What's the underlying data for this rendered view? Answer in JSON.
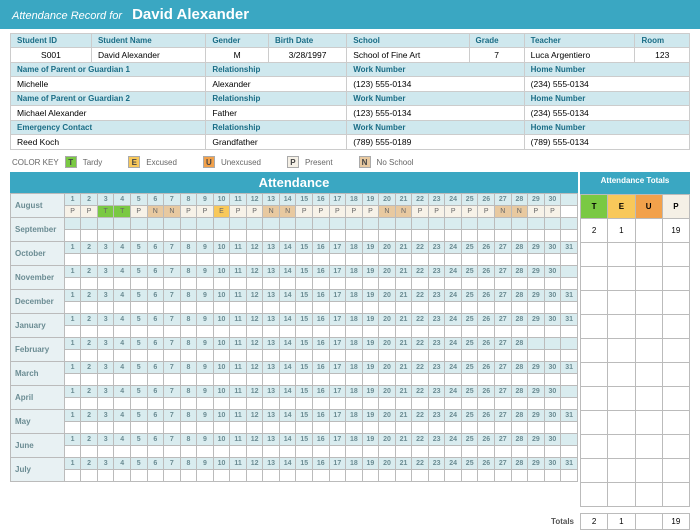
{
  "header": {
    "label": "Attendance Record for",
    "student_name": "David Alexander"
  },
  "student": {
    "id_label": "Student ID",
    "id": "S001",
    "name_label": "Student Name",
    "name": "David Alexander",
    "gender_label": "Gender",
    "gender": "M",
    "birth_label": "Birth Date",
    "birth": "3/28/1997",
    "school_label": "School",
    "school": "School of Fine Art",
    "grade_label": "Grade",
    "grade": "7",
    "teacher_label": "Teacher",
    "teacher": "Luca Argentiero",
    "room_label": "Room",
    "room": "123",
    "g1_label": "Name of Parent or Guardian 1",
    "g1_name": "Michelle",
    "g1_rel_label": "Relationship",
    "g1_rel": "Alexander",
    "g1_work_label": "Work Number",
    "g1_work": "(123) 555-0134",
    "g1_home_label": "Home Number",
    "g1_home": "(234) 555-0134",
    "g2_label": "Name of Parent or Guardian 2",
    "g2_name": "Michael Alexander",
    "g2_rel_label": "Relationship",
    "g2_rel": "Father",
    "g2_work_label": "Work Number",
    "g2_work": "(123) 555-0134",
    "g2_home_label": "Home Number",
    "g2_home": "(234) 555-0134",
    "ec_label": "Emergency Contact",
    "ec_name": "Reed Koch",
    "ec_rel_label": "Relationship",
    "ec_rel": "Grandfather",
    "ec_work_label": "Work Number",
    "ec_work": "(789) 555-0189",
    "ec_home_label": "Home Number",
    "ec_home": "(789) 555-0134"
  },
  "color_key": {
    "label": "COLOR KEY",
    "t": "Tardy",
    "e": "Excused",
    "u": "Unexcused",
    "p": "Present",
    "n": "No School"
  },
  "attendance": {
    "title": "Attendance",
    "months": [
      {
        "name": "August",
        "days": 30,
        "status": [
          "P",
          "P",
          "T",
          "T",
          "P",
          "N",
          "N",
          "P",
          "P",
          "E",
          "P",
          "P",
          "N",
          "N",
          "P",
          "P",
          "P",
          "P",
          "P",
          "N",
          "N",
          "P",
          "P",
          "P",
          "P",
          "P",
          "N",
          "N",
          "P",
          "P"
        ]
      },
      {
        "name": "September",
        "days": 0,
        "status": []
      },
      {
        "name": "October",
        "days": 31,
        "status": []
      },
      {
        "name": "November",
        "days": 30,
        "status": []
      },
      {
        "name": "December",
        "days": 31,
        "status": []
      },
      {
        "name": "January",
        "days": 31,
        "status": []
      },
      {
        "name": "February",
        "days": 28,
        "status": []
      },
      {
        "name": "March",
        "days": 31,
        "status": []
      },
      {
        "name": "April",
        "days": 30,
        "status": []
      },
      {
        "name": "May",
        "days": 31,
        "status": []
      },
      {
        "name": "June",
        "days": 30,
        "status": []
      },
      {
        "name": "July",
        "days": 31,
        "status": []
      }
    ]
  },
  "totals": {
    "title": "Attendance Totals",
    "cols": {
      "t": "T",
      "e": "E",
      "u": "U",
      "p": "P"
    },
    "august": {
      "t": "2",
      "e": "1",
      "u": "",
      "p": "19"
    },
    "grand_label": "Totals",
    "grand": {
      "t": "2",
      "e": "1",
      "u": "",
      "p": "19"
    }
  }
}
